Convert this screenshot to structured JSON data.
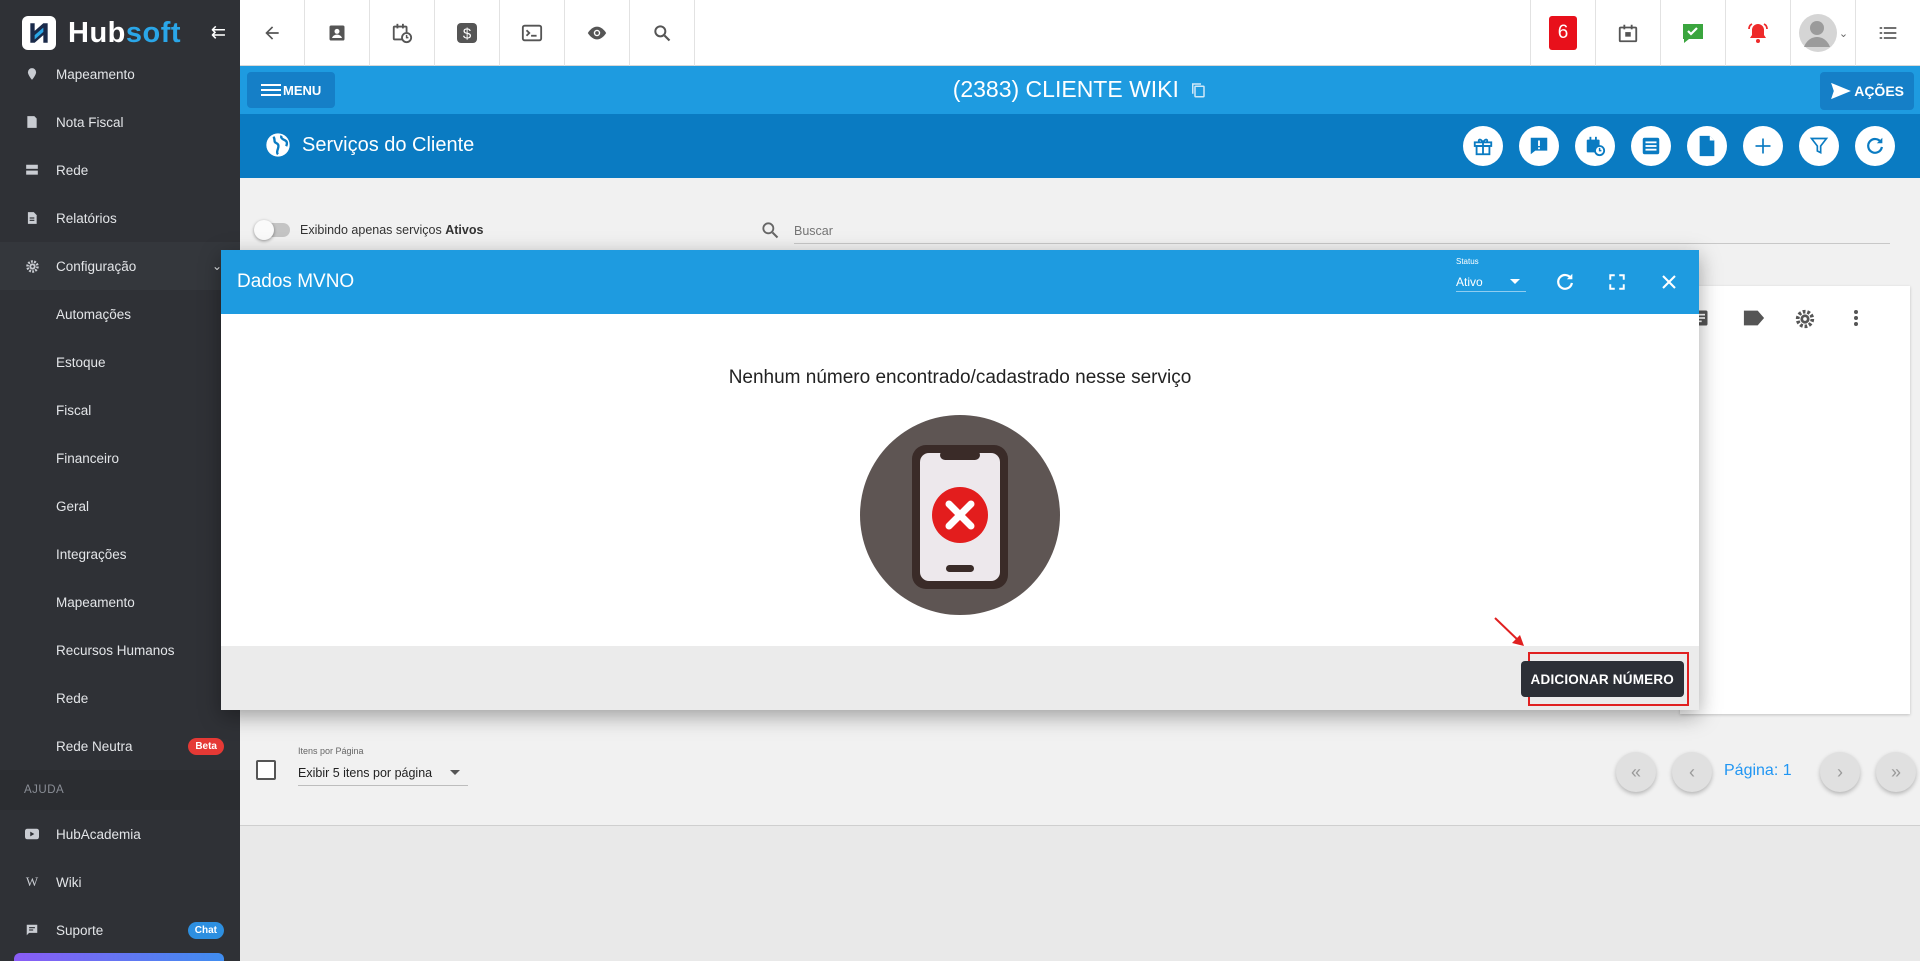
{
  "sidebar": {
    "brand_hub": "Hub",
    "brand_soft": "soft",
    "items": [
      {
        "label": "Mapeamento",
        "icon": "map-icon"
      },
      {
        "label": "Nota Fiscal",
        "icon": "document-icon"
      },
      {
        "label": "Rede",
        "icon": "server-icon"
      },
      {
        "label": "Relatórios",
        "icon": "report-icon"
      },
      {
        "label": "Configuração",
        "icon": "gear-icon"
      }
    ],
    "config_sub": [
      "Automações",
      "Estoque",
      "Fiscal",
      "Financeiro",
      "Geral",
      "Integrações",
      "Mapeamento",
      "Recursos Humanos",
      "Rede",
      "Rede Neutra"
    ],
    "rede_neutra_badge": "Beta",
    "help_section": "AJUDA",
    "help_items": [
      {
        "label": "HubAcademia",
        "icon": "youtube-icon"
      },
      {
        "label": "Wiki",
        "icon": "wikipedia-icon"
      },
      {
        "label": "Suporte",
        "icon": "chat-icon"
      }
    ],
    "suporte_badge": "Chat"
  },
  "topbar": {
    "notification_count": "6"
  },
  "clientbar": {
    "menu_label": "MENU",
    "client_title": "(2383) CLIENTE WIKI",
    "acoes_label": "AÇÕES"
  },
  "services": {
    "title": "Serviços do Cliente",
    "toggle_label_prefix": "Exibindo apenas serviços ",
    "toggle_label_bold": "Ativos",
    "search_placeholder": "Buscar",
    "items_per_page_label": "Itens por Página",
    "items_per_page_value": "Exibir 5 itens por página",
    "page_label": "Página: 1"
  },
  "modal": {
    "title": "Dados MVNO",
    "status_label": "Status",
    "status_value": "Ativo",
    "empty_message": "Nenhum número encontrado/cadastrado nesse serviço",
    "add_button": "ADICIONAR NÚMERO"
  },
  "colors": {
    "primary_blue": "#1e9be0",
    "header_blue": "#0a7bc2",
    "sidebar_bg": "#2f3136",
    "danger_red": "#e8101b"
  }
}
